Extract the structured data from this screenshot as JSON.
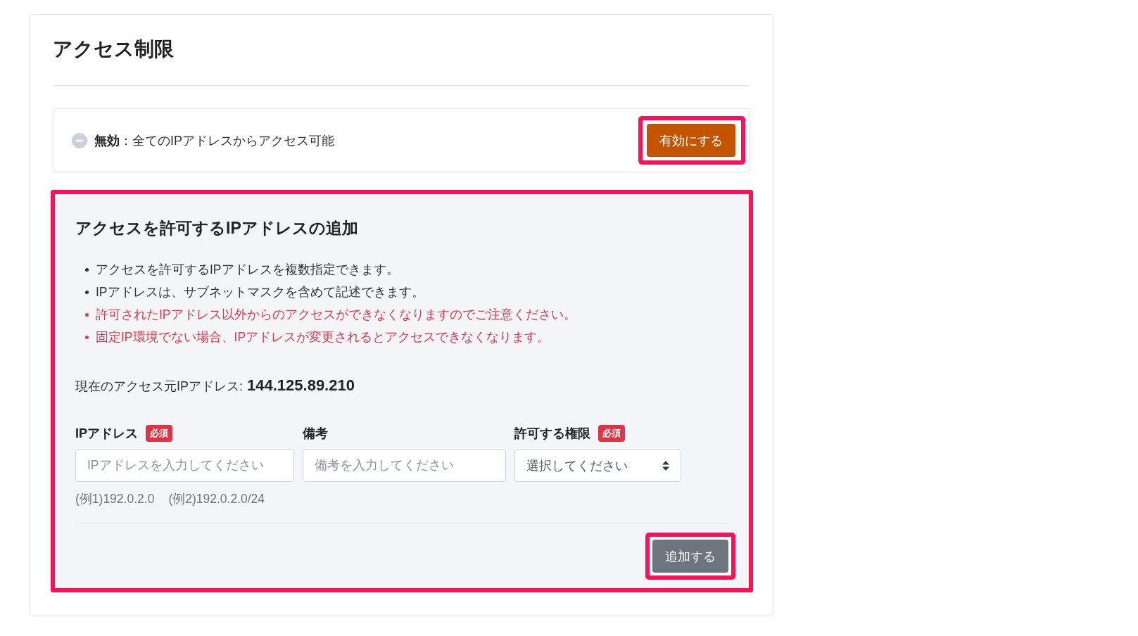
{
  "page": {
    "title": "アクセス制限"
  },
  "status": {
    "enabled": false,
    "text": "**無効**：全てのIPアドレスからアクセス可能",
    "button": {
      "label": "有効にする",
      "highlighted": true
    }
  },
  "add_section": {
    "highlighted": true,
    "title": "アクセスを許可するIPアドレスの追加",
    "notes": [
      {
        "kind": "info",
        "text": "アクセスを許可するIPアドレスを複数指定できます。"
      },
      {
        "kind": "info",
        "text": "IPアドレスは、サブネットマスクを含めて記述できます。"
      },
      {
        "kind": "warning",
        "text": "許可されたIPアドレス以外からのアクセスができなくなりますのでご注意ください。"
      },
      {
        "kind": "warning",
        "text": "固定IP環境でない場合、IPアドレスが変更されるとアクセスできなくなります。"
      }
    ],
    "current_ip": {
      "label": "現在のアクセス元IPアドレス:",
      "value": "144.125.89.210"
    },
    "fields": [
      {
        "kind": "text",
        "label": "IPアドレス",
        "badge": "必須",
        "placeholder": "IPアドレスを入力してください",
        "examples": [
          "(例1)192.0.2.0",
          "(例2)192.0.2.0/24"
        ]
      },
      {
        "kind": "text",
        "label": "備考",
        "placeholder": "備考を入力してください"
      },
      {
        "kind": "select",
        "label": "許可する権限",
        "badge": "必須",
        "placeholder": "選択してください"
      }
    ],
    "submit": {
      "label": "追加する",
      "highlighted": true
    }
  }
}
